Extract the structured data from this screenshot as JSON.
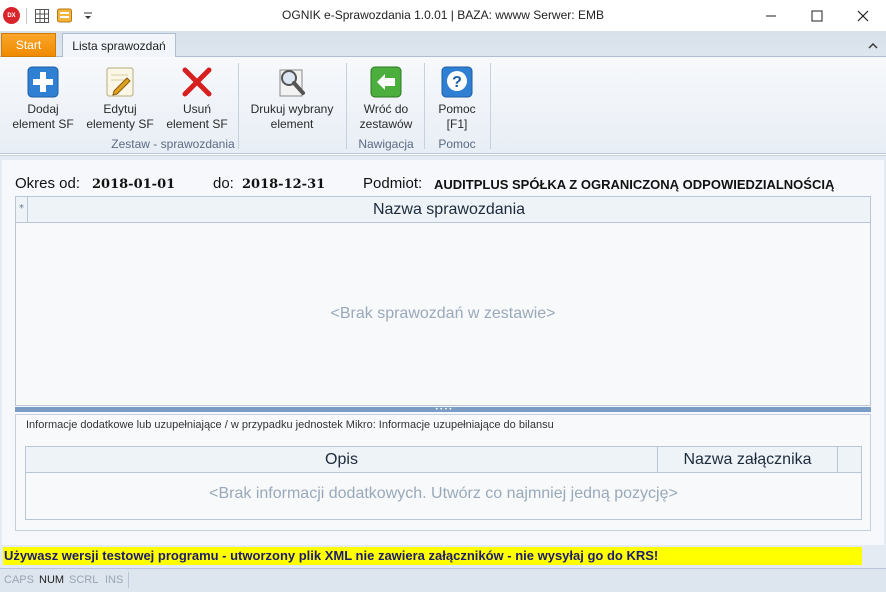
{
  "window": {
    "title": "OGNIK e-Sprawozdania 1.0.01 | BAZA: wwww Serwer: EMB",
    "logo_text": "DX"
  },
  "tabs": {
    "start": "Start",
    "active": "Lista sprawozdań"
  },
  "ribbon": {
    "buttons": {
      "add": [
        "Dodaj",
        "element SF"
      ],
      "edit": [
        "Edytuj",
        "elementy SF"
      ],
      "delete": [
        "Usuń",
        "element SF"
      ],
      "print": [
        "Drukuj wybrany",
        "element"
      ],
      "back": [
        "Wróć do",
        "zestawów"
      ],
      "help": [
        "Pomoc",
        "[F1]"
      ]
    },
    "groups": {
      "zestaw": "Zestaw - sprawozdania",
      "nawigacja": "Nawigacja",
      "pomoc": "Pomoc"
    }
  },
  "header": {
    "okres_label": "Okres od:",
    "okres_od": "2018-01-01",
    "do_label": "do:",
    "okres_do": "2018-12-31",
    "podmiot_label": "Podmiot:",
    "podmiot": "AUDITPLUS SPÓŁKA Z OGRANICZONĄ ODPOWIEDZIALNOŚCIĄ"
  },
  "grid_reports": {
    "corner": "*",
    "column": "Nazwa sprawozdania",
    "empty_text": "<Brak sprawozdań w zestawie>"
  },
  "panel_info": {
    "title": "Informacje dodatkowe lub uzupełniające / w przypadku jednostek Mikro: Informacje uzupełniające do bilansu",
    "columns": [
      "Opis",
      "Nazwa załącznika"
    ],
    "empty_text": "<Brak informacji dodatkowych. Utwórz co najmniej jedną pozycję>"
  },
  "warning": "Używasz wersji testowej programu - utworzony plik XML nie zawiera załączników - nie wysyłaj go do KRS!",
  "statusbar": {
    "caps": "CAPS",
    "num": "NUM",
    "scrl": "SCRL",
    "ins": "INS"
  },
  "colors": {
    "accent_orange": "#f08a00",
    "warning_bg": "#ffff00",
    "ribbon_bg": "#eef3f8"
  }
}
